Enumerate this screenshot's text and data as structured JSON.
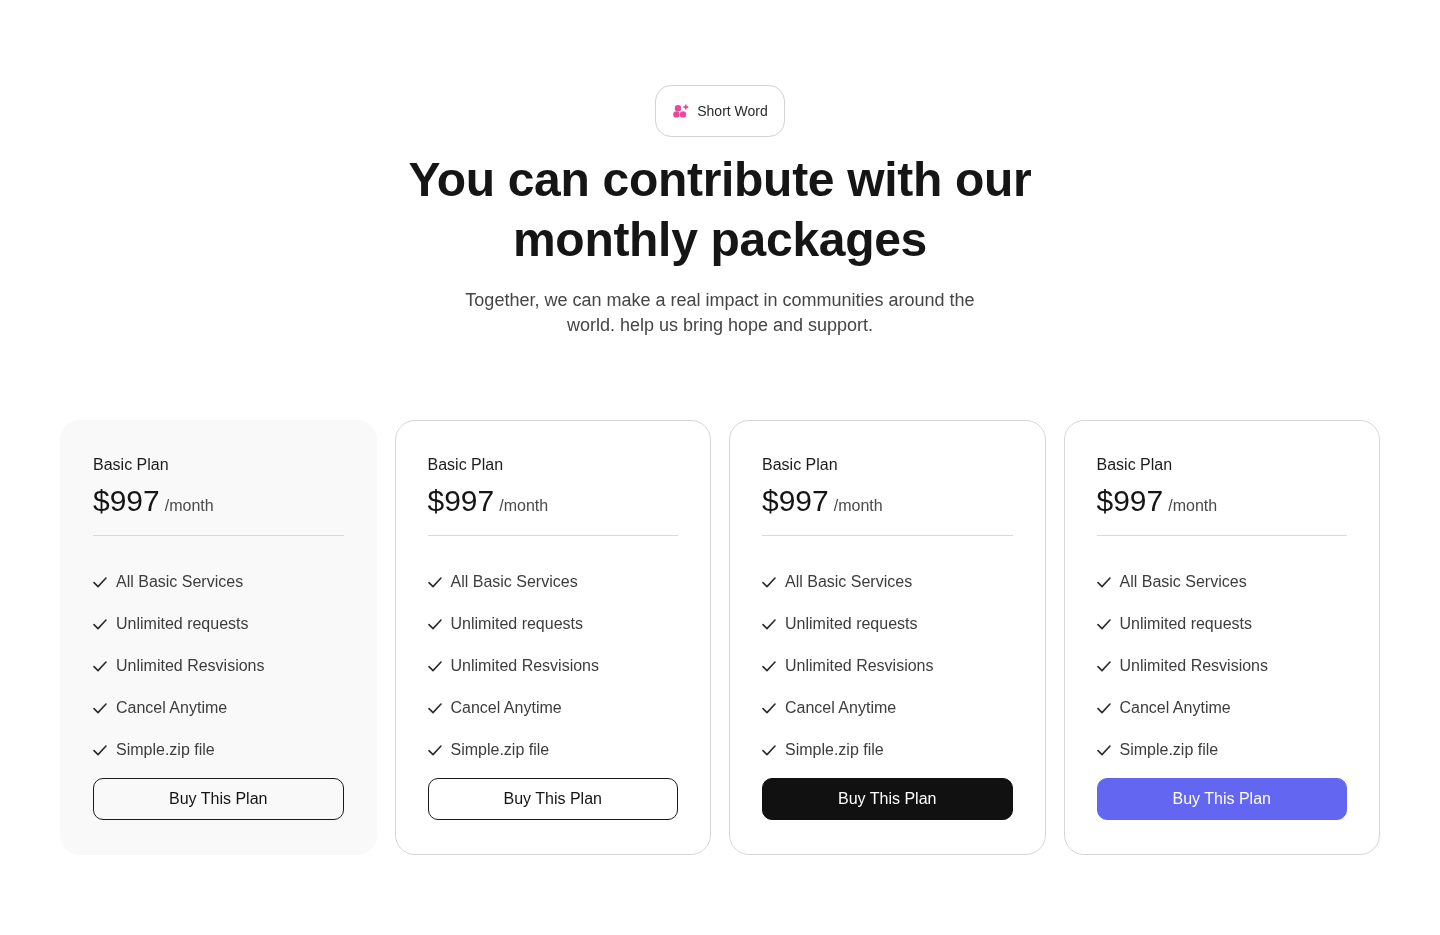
{
  "badge": {
    "label": "Short Word"
  },
  "heading": "You can contribute with our monthly packages",
  "subtitle": "Together, we can make a real impact in communities around the world. help us bring hope and support.",
  "plans": [
    {
      "kind": "shaded",
      "name": "Basic Plan",
      "price": "$997",
      "period": "/month",
      "features": [
        "All Basic Services",
        "Unlimited requests",
        "Unlimited Resvisions",
        "Cancel Anytime",
        "Simple.zip file"
      ],
      "button": {
        "label": "Buy This Plan",
        "kind": "outline"
      }
    },
    {
      "kind": "outlined",
      "name": "Basic Plan",
      "price": "$997",
      "period": "/month",
      "features": [
        "All Basic Services",
        "Unlimited requests",
        "Unlimited Resvisions",
        "Cancel Anytime",
        "Simple.zip file"
      ],
      "button": {
        "label": "Buy This Plan",
        "kind": "outline"
      }
    },
    {
      "kind": "outlined",
      "name": "Basic Plan",
      "price": "$997",
      "period": "/month",
      "features": [
        "All Basic Services",
        "Unlimited requests",
        "Unlimited Resvisions",
        "Cancel Anytime",
        "Simple.zip file"
      ],
      "button": {
        "label": "Buy This Plan",
        "kind": "dark"
      }
    },
    {
      "kind": "outlined",
      "name": "Basic Plan",
      "price": "$997",
      "period": "/month",
      "features": [
        "All Basic Services",
        "Unlimited requests",
        "Unlimited Resvisions",
        "Cancel Anytime",
        "Simple.zip file"
      ],
      "button": {
        "label": "Buy This Plan",
        "kind": "accent"
      }
    }
  ]
}
